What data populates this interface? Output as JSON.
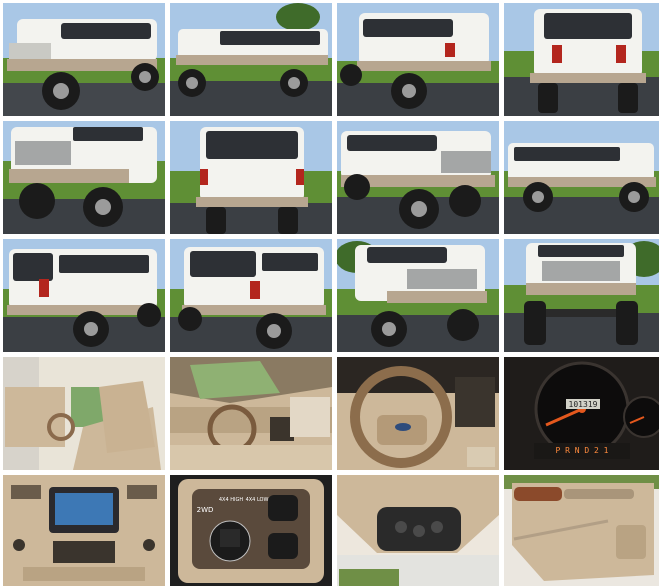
{
  "gallery": {
    "photos": [
      {
        "subject": "exterior-front-left"
      },
      {
        "subject": "exterior-side-left"
      },
      {
        "subject": "exterior-rear-left"
      },
      {
        "subject": "exterior-rear"
      },
      {
        "subject": "exterior-front-left-close"
      },
      {
        "subject": "exterior-rear-straight"
      },
      {
        "subject": "exterior-front-right"
      },
      {
        "subject": "exterior-side-right"
      },
      {
        "subject": "exterior-rear-left-2"
      },
      {
        "subject": "exterior-rear-right"
      },
      {
        "subject": "exterior-front-three-quarter"
      },
      {
        "subject": "exterior-front"
      },
      {
        "subject": "interior-driver-door"
      },
      {
        "subject": "interior-dash-wide"
      },
      {
        "subject": "interior-steering-wheel"
      },
      {
        "subject": "interior-instrument-cluster"
      },
      {
        "subject": "interior-head-unit"
      },
      {
        "subject": "interior-4x4-switch"
      },
      {
        "subject": "interior-overhead-console"
      },
      {
        "subject": "interior-door-panel"
      }
    ],
    "cluster": {
      "odometer": "101319",
      "gear": "P R N D 2 1",
      "speed_ticks": [
        "10",
        "20",
        "30",
        "40",
        "50",
        "60",
        "70",
        "80",
        "90",
        "100"
      ],
      "tach_ticks": [
        "1",
        "2",
        "3",
        "4",
        "5",
        "6"
      ]
    },
    "switch": {
      "left_label": "2WD",
      "mid_label": "4X4 HIGH",
      "right_label": "4X4 LOW"
    },
    "head_unit": {
      "brand": "Pioneer"
    },
    "colors": {
      "sky": "#a9c7e6",
      "grass": "#5f8f35",
      "pavement": "#3b3f44",
      "truck_white": "#f3f3ef",
      "bumper_tan": "#b7a690",
      "interior_tan": "#cdb89a",
      "dash_dark": "#2b2622"
    }
  }
}
